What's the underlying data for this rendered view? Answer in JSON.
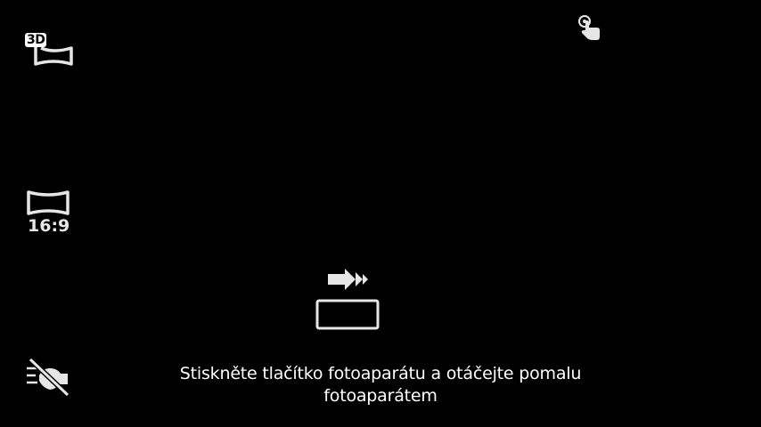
{
  "modes": {
    "three_d": {
      "badge": "3D",
      "icon": "3d-panorama-icon"
    },
    "aspect": {
      "ratio_label": "16:9",
      "icon": "panorama-aspect-icon"
    },
    "flash": {
      "icon": "flash-off-icon",
      "state": "off"
    }
  },
  "touch_capture": {
    "icon": "touch-capture-icon"
  },
  "sweep": {
    "icon": "sweep-direction-icon",
    "direction": "right"
  },
  "hint": {
    "text": "Stiskněte tlačítko fotoaparátu a otáčejte pomalu fotoaparátem"
  },
  "colors": {
    "background": "#000000",
    "foreground": "#ffffff",
    "icon_grey": "#e6e6e6"
  }
}
